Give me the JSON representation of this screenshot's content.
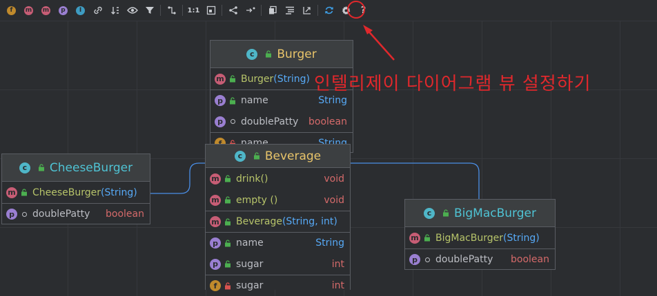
{
  "toolbar": {
    "items": [
      {
        "name": "fields-filter-icon",
        "glyph": "f",
        "color": "#c08a2c"
      },
      {
        "name": "constructors-filter-icon",
        "glyph": "m",
        "color": "#c75d75"
      },
      {
        "name": "methods-filter-icon",
        "glyph": "m",
        "color": "#c75d75"
      },
      {
        "name": "properties-filter-icon",
        "glyph": "p",
        "color": "#9a7fd1"
      },
      {
        "name": "inner-classes-filter-icon",
        "glyph": "I",
        "color": "#3e9cc2"
      },
      {
        "name": "link-icon",
        "glyph": "🔗",
        "color": ""
      },
      {
        "name": "sort-icon",
        "glyph": "↓⋮",
        "color": ""
      },
      {
        "name": "eye-icon",
        "glyph": "👁",
        "color": ""
      },
      {
        "name": "filter-icon",
        "glyph": "▼",
        "color": ""
      },
      {
        "name": "route-icon",
        "glyph": "⤷",
        "color": ""
      },
      {
        "name": "actual-size-icon",
        "glyph": "1:1",
        "color": ""
      },
      {
        "name": "fit-content-icon",
        "glyph": "▢",
        "color": ""
      },
      {
        "name": "layout-icon",
        "glyph": "⊰",
        "color": ""
      },
      {
        "name": "apply-layout-icon",
        "glyph": "→·",
        "color": ""
      },
      {
        "name": "copy-icon",
        "glyph": "⧉",
        "color": ""
      },
      {
        "name": "export-text-icon",
        "glyph": "☰",
        "color": ""
      },
      {
        "name": "export-image-icon",
        "glyph": "⤢",
        "color": ""
      },
      {
        "name": "refresh-icon",
        "glyph": "⟳",
        "color": "#3ea0e8"
      },
      {
        "name": "gear-icon",
        "glyph": "⚙",
        "color": ""
      },
      {
        "name": "help-icon",
        "glyph": "?",
        "color": ""
      }
    ]
  },
  "annotation": "인텔리제이 다이어그램 뷰 설정하기",
  "nodes": {
    "burger": {
      "title": "Burger",
      "rows": [
        {
          "badge": "m",
          "name": "Burger",
          "params": "(String)",
          "type": "",
          "method": true
        },
        {
          "badge": "p",
          "name": "name",
          "type": "String"
        },
        {
          "badge": "p",
          "name": "doublePatty",
          "type": "boolean"
        },
        {
          "badge": "f",
          "name": "name",
          "type": "String"
        }
      ]
    },
    "beverage": {
      "title": "Beverage",
      "rows": [
        {
          "badge": "m",
          "name": "drink()",
          "type": "void"
        },
        {
          "badge": "m",
          "name": "empty ()",
          "type": "void"
        },
        {
          "badge": "m",
          "name": "Beverage",
          "params": "(String, int)",
          "type": "",
          "method": true
        },
        {
          "badge": "p",
          "name": "name",
          "type": "String"
        },
        {
          "badge": "p",
          "name": "sugar",
          "type": "int"
        },
        {
          "badge": "f",
          "name": "sugar",
          "type": "int"
        }
      ]
    },
    "cheese": {
      "title": "CheeseBurger",
      "rows": [
        {
          "badge": "m",
          "name": "CheeseBurger",
          "params": "(String)",
          "type": "",
          "method": true
        },
        {
          "badge": "p",
          "name": "doublePatty",
          "type": "boolean"
        }
      ]
    },
    "bigmac": {
      "title": "BigMacBurger",
      "rows": [
        {
          "badge": "m",
          "name": "BigMacBurger",
          "params": "(String)",
          "type": "",
          "method": true
        },
        {
          "badge": "p",
          "name": "doublePatty",
          "type": "boolean"
        }
      ]
    }
  }
}
